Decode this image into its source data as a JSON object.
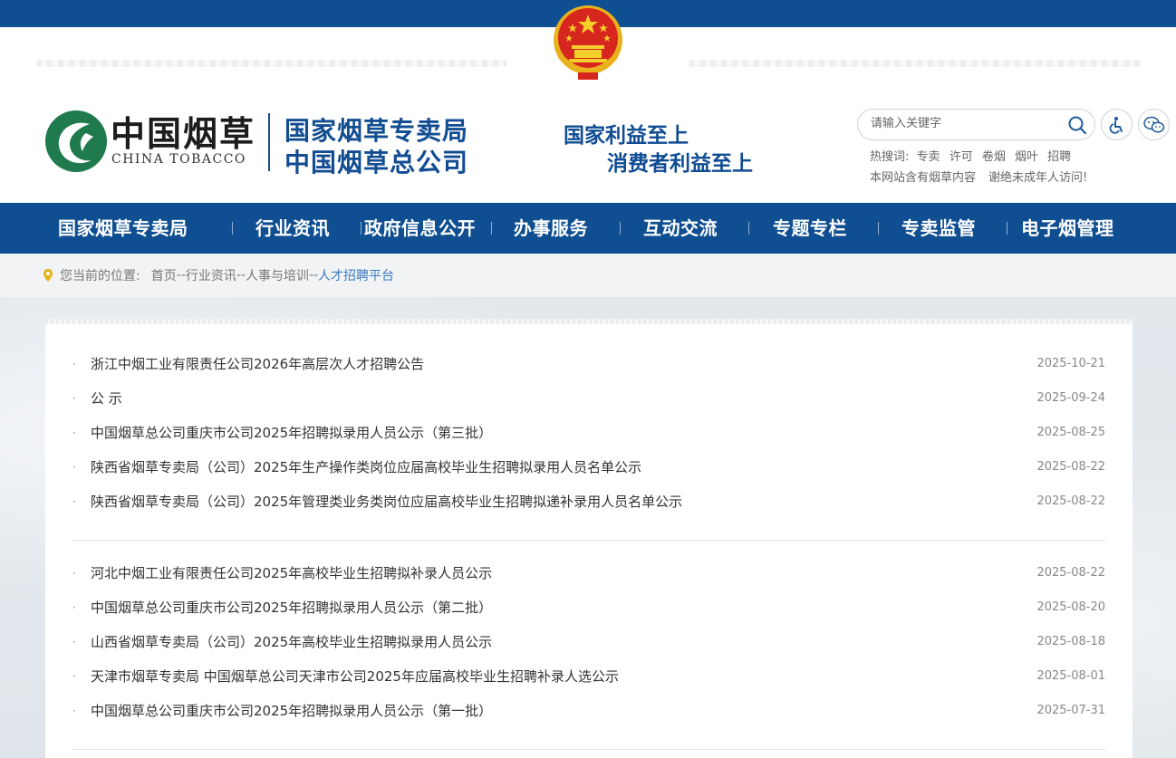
{
  "header": {
    "logo_cn": "中国烟草",
    "logo_en": "CHINA TOBACCO",
    "org_line1": "国家烟草专卖局",
    "org_line2": "中国烟草总公司",
    "slogan_line1": "国家利益至上",
    "slogan_line2": "消费者利益至上"
  },
  "search": {
    "placeholder": "请输入关键字",
    "value": ""
  },
  "hot_search": {
    "label": "热搜词:",
    "keywords": [
      "专卖",
      "许可",
      "卷烟",
      "烟叶",
      "招聘"
    ]
  },
  "notice": {
    "line1": "本网站含有烟草内容",
    "line2": "谢绝未成年人访问!"
  },
  "nav": {
    "items": [
      "国家烟草专卖局",
      "行业资讯",
      "政府信息公开",
      "办事服务",
      "互动交流",
      "专题专栏",
      "专卖监管",
      "电子烟管理"
    ]
  },
  "breadcrumb": {
    "label": "您当前的位置:",
    "items": [
      "首页",
      "行业资讯",
      "人事与培训",
      "人才招聘平台"
    ],
    "separator": "--"
  },
  "list_group1": [
    {
      "title": "浙江中烟工业有限责任公司2026年高层次人才招聘公告",
      "date": "2025-10-21"
    },
    {
      "title": "公 示",
      "date": "2025-09-24"
    },
    {
      "title": "中国烟草总公司重庆市公司2025年招聘拟录用人员公示（第三批）",
      "date": "2025-08-25"
    },
    {
      "title": "陕西省烟草专卖局（公司）2025年生产操作类岗位应届高校毕业生招聘拟录用人员名单公示",
      "date": "2025-08-22"
    },
    {
      "title": "陕西省烟草专卖局（公司）2025年管理类业务类岗位应届高校毕业生招聘拟递补录用人员名单公示",
      "date": "2025-08-22"
    }
  ],
  "list_group2": [
    {
      "title": "河北中烟工业有限责任公司2025年高校毕业生招聘拟补录人员公示",
      "date": "2025-08-22"
    },
    {
      "title": "中国烟草总公司重庆市公司2025年招聘拟录用人员公示（第二批）",
      "date": "2025-08-20"
    },
    {
      "title": "山西省烟草专卖局（公司）2025年高校毕业生招聘拟录用人员公示",
      "date": "2025-08-18"
    },
    {
      "title": "天津市烟草专卖局 中国烟草总公司天津市公司2025年应届高校毕业生招聘补录人选公示",
      "date": "2025-08-01"
    },
    {
      "title": "中国烟草总公司重庆市公司2025年招聘拟录用人员公示（第一批）",
      "date": "2025-07-31"
    }
  ],
  "colors": {
    "brand_blue": "#0f4f91",
    "text_blue": "#124d92",
    "logo_green": "#1f7a4d",
    "crumb_current": "#3a79c0"
  },
  "icons": {
    "emblem": "national-emblem-icon",
    "search": "search-icon",
    "accessibility": "accessibility-icon",
    "wechat": "wechat-icon",
    "location": "location-pin-icon"
  }
}
